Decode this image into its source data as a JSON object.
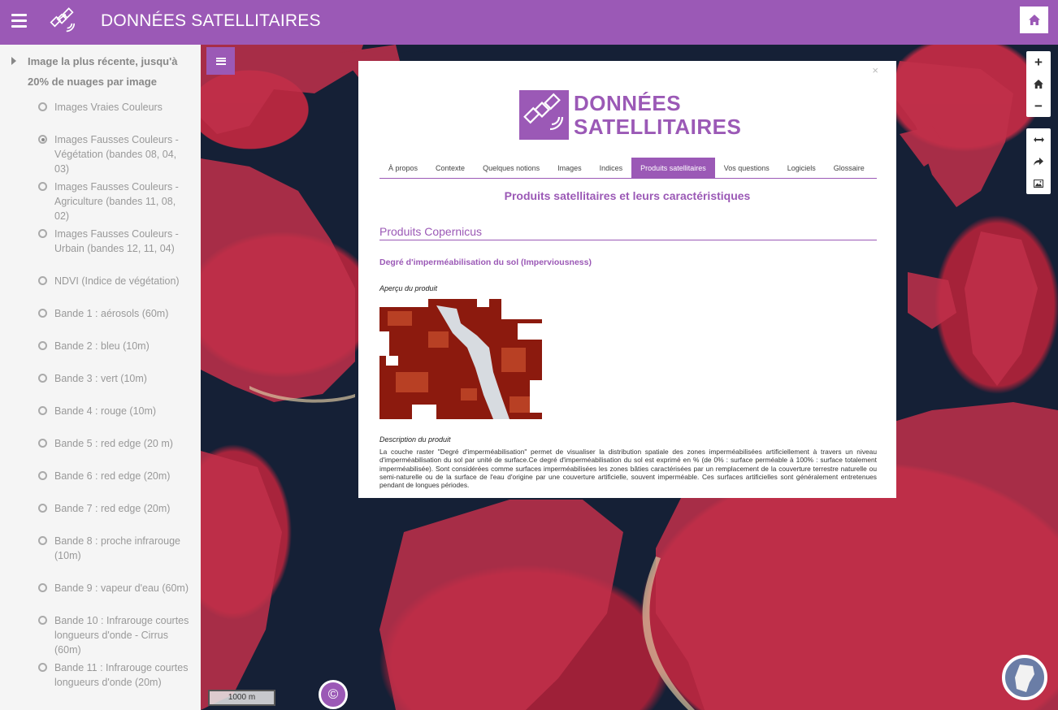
{
  "header": {
    "title": "DONNÉES SATELLITAIRES"
  },
  "sidebar": {
    "group_label": "Image la plus récente, jusqu'à 20% de nuages par image",
    "items": [
      {
        "label": "Images Vraies Couleurs",
        "selected": false
      },
      {
        "label": "Images Fausses Couleurs - Végétation (bandes 08, 04, 03)",
        "selected": true
      },
      {
        "label": "Images Fausses Couleurs - Agriculture (bandes 11, 08, 02)",
        "selected": false
      },
      {
        "label": "Images Fausses Couleurs - Urbain (bandes 12, 11, 04)",
        "selected": false
      },
      {
        "label": "NDVI (Indice de végétation)",
        "selected": false
      },
      {
        "label": "Bande 1 : aérosols (60m)",
        "selected": false
      },
      {
        "label": "Bande 2 : bleu (10m)",
        "selected": false
      },
      {
        "label": "Bande 3 : vert (10m)",
        "selected": false
      },
      {
        "label": "Bande 4 : rouge (10m)",
        "selected": false
      },
      {
        "label": "Bande 5 : red edge (20 m)",
        "selected": false
      },
      {
        "label": "Bande 6 : red edge (20m)",
        "selected": false
      },
      {
        "label": "Bande 7 : red edge (20m)",
        "selected": false
      },
      {
        "label": "Bande 8 : proche infrarouge (10m)",
        "selected": false
      },
      {
        "label": "Bande 9 : vapeur d'eau (60m)",
        "selected": false
      },
      {
        "label": "Bande 10 : Infrarouge courtes longueurs d'onde - Cirrus (60m)",
        "selected": false
      },
      {
        "label": "Bande 11 : Infrarouge courtes longueurs d'onde (20m)",
        "selected": false
      }
    ]
  },
  "map": {
    "scale_label": "1000 m",
    "copyright_symbol": "©"
  },
  "modal": {
    "close": "×",
    "brand_line1": "DONNÉES",
    "brand_line2": "SATELLITAIRES",
    "tabs": [
      "À propos",
      "Contexte",
      "Quelques notions",
      "Images",
      "Indices",
      "Produits satellitaires",
      "Vos questions",
      "Logiciels",
      "Glossaire"
    ],
    "active_tab": "Produits satellitaires",
    "heading": "Produits satellitaires et leurs caractéristiques",
    "section": "Produits Copernicus",
    "product_title": "Degré d'imperméabilisation du sol (Imperviousness)",
    "preview_label": "Aperçu du produit",
    "description_label": "Description du produit",
    "description": "La couche raster \"Degré d'imperméabilisation\" permet de visualiser la distribution spatiale des zones imperméabilisées artificiellement à travers un niveau d'imperméabilisation du sol par unité de surface.Ce degré d'imperméabilisation du sol est exprimé en % (de 0% : surface perméable à 100% : surface totalement imperméabilisée). Sont considérées comme surfaces imperméabilisées les zones bâties caractérisées par un remplacement de la couverture terrestre naturelle ou semi-naturelle ou de la surface de l'eau d'origine par une couverture artificielle, souvent imperméable. Ces surfaces artificielles sont généralement entretenues pendant de longues périodes."
  },
  "colors": {
    "accent": "#9b59b6",
    "map_vegetation": "#b3273f",
    "map_water": "#152036"
  }
}
